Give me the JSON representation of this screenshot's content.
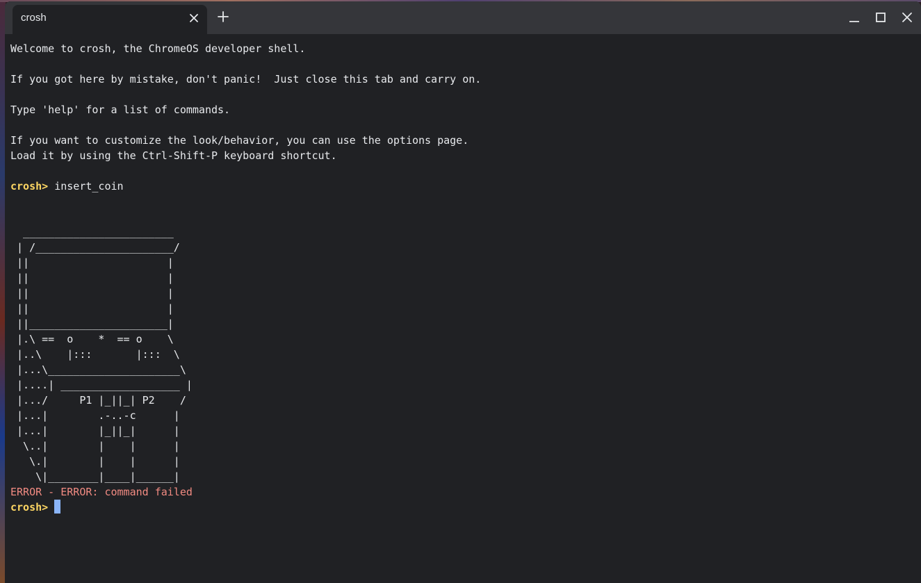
{
  "tab": {
    "title": "crosh"
  },
  "icons": {
    "tab_close": "close-icon",
    "new_tab": "plus-icon",
    "minimize": "minimize-icon",
    "maximize": "maximize-icon",
    "close": "close-icon"
  },
  "colors": {
    "prompt": "#fdd663",
    "error": "#f28b82",
    "cursor": "#8ab4f8",
    "text": "#e8eaed",
    "background": "#202124"
  },
  "terminal": {
    "welcome": "Welcome to crosh, the ChromeOS developer shell.",
    "mistake": "If you got here by mistake, don't panic!  Just close this tab and carry on.",
    "help": "Type 'help' for a list of commands.",
    "customize_1": "If you want to customize the look/behavior, you can use the options page.",
    "customize_2": "Load it by using the Ctrl-Shift-P keyboard shortcut.",
    "prompt_label": "crosh>",
    "command": "insert_coin",
    "ascii_art": [
      "  ________________________",
      " | /______________________/",
      " ||                      |",
      " ||                      |",
      " ||                      |",
      " ||                      |",
      " ||______________________|",
      " |.\\ ==  o    *  == o    \\",
      " |..\\    |:::       |:::  \\",
      " |...\\_____________________\\",
      " |....| ___________________ |",
      " |.../     P1 |_||_| P2    /",
      " |...|        .-..-c      |",
      " |...|        |_||_|      |",
      "  \\..|        |    |      |",
      "   \\.|        |    |      |",
      "    \\|________|____|______|"
    ],
    "error": "ERROR - ERROR: command failed",
    "prompt_label_2": "crosh>"
  }
}
